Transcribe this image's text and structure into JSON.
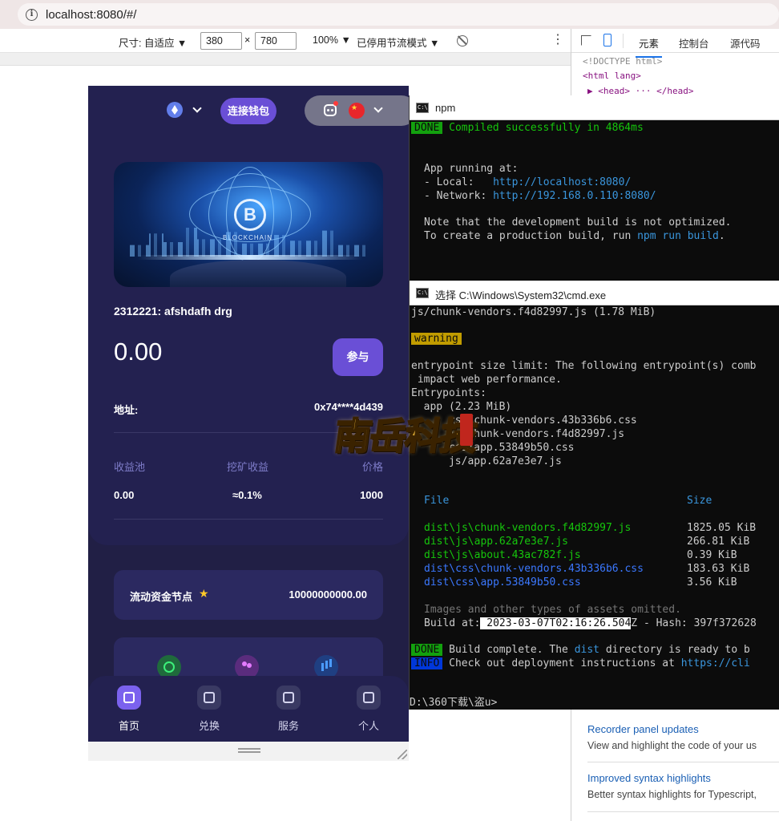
{
  "browser": {
    "url": "localhost:8080/#/"
  },
  "device_toolbar": {
    "size_label": "尺寸: 自适应 ▼",
    "width": "380",
    "times": "×",
    "height": "780",
    "zoom": "100% ▼",
    "throttle": "已停用节流模式 ▼",
    "more": "⋮"
  },
  "devtools": {
    "tabs": [
      "元素",
      "控制台",
      "源代码"
    ],
    "code": [
      "<!DOCTYPE html>",
      "<html lang>",
      "▶ <head> ··· </head>"
    ],
    "whats_new": [
      {
        "title": "Recorder panel updates",
        "desc": "View and highlight the code of your us"
      },
      {
        "title": "Improved syntax highlights",
        "desc": "Better syntax highlights for Typescript,"
      }
    ]
  },
  "app": {
    "connect_wallet": "连接钱包",
    "card_title": "2312221: afshdafh drg",
    "amount": "0.00",
    "join_button": "参与",
    "address_label": "地址:",
    "address_value": "0x74****4d439",
    "stats": [
      {
        "label": "收益池",
        "value": "0.00"
      },
      {
        "label": "挖矿收益",
        "value": "≈0.1%"
      },
      {
        "label": "价格",
        "value": "1000"
      }
    ],
    "banner_text": "BLOCKCHAIN",
    "banner_coin": "B",
    "node_label": "流动资金节点",
    "node_value": "10000000000.00",
    "tabs": [
      "首页",
      "兑换",
      "服务",
      "个人"
    ]
  },
  "npm_window": {
    "title": "npm",
    "done_badge": "DONE",
    "compiled": " Compiled successfully in 4864ms",
    "app_running": "App running at:",
    "local_label": "- Local:   ",
    "local_url": "http://localhost:8080/",
    "network_label": "- Network: ",
    "network_url": "http://192.168.0.110:8080/",
    "note1": "Note that the development build is not optimized.",
    "note2_pre": "To create a production build, run ",
    "note2_cmd": "npm run build",
    "note2_post": "."
  },
  "cmd_window": {
    "title": "选择 C:\\Windows\\System32\\cmd.exe",
    "line1": "js/chunk-vendors.f4d82997.js (1.78 MiB)",
    "warning_badge": "warning",
    "warn1": "entrypoint size limit: The following entrypoint(s) comb",
    "warn2": " impact web performance.",
    "warn3": "Entrypoints:",
    "warn4": "  app (2.23 MiB)",
    "warn5": "      css/chunk-vendors.43b336b6.css",
    "warn6": "      js/chunk-vendors.f4d82997.js",
    "warn7": "      css/app.53849b50.css",
    "warn8": "      js/app.62a7e3e7.js",
    "file_header": "File",
    "size_header": "Size",
    "files": [
      {
        "name": "dist\\js\\chunk-vendors.f4d82997.js",
        "size": "1825.05 KiB",
        "kind": "js"
      },
      {
        "name": "dist\\js\\app.62a7e3e7.js",
        "size": "266.81 KiB",
        "kind": "js"
      },
      {
        "name": "dist\\js\\about.43ac782f.js",
        "size": "0.39 KiB",
        "kind": "js"
      },
      {
        "name": "dist\\css\\chunk-vendors.43b336b6.css",
        "size": "183.63 KiB",
        "kind": "css"
      },
      {
        "name": "dist\\css\\app.53849b50.css",
        "size": "3.56 KiB",
        "kind": "css"
      }
    ],
    "omitted": "Images and other types of assets omitted.",
    "build_at_label": "Build at:",
    "build_at_sel": " 2023-03-07T02:16:26.504",
    "build_at_rest": "Z - Hash: 397f372628",
    "done_badge": "DONE",
    "done_pre": " Build complete. The ",
    "done_dist": "dist",
    "done_post": " directory is ready to b",
    "info_badge": "INFO",
    "info_pre": " Check out deployment instructions at ",
    "info_url": "https://cli",
    "prompt": "D:\\360下载\\盗u>"
  },
  "watermark": {
    "text": "南岳科技"
  }
}
